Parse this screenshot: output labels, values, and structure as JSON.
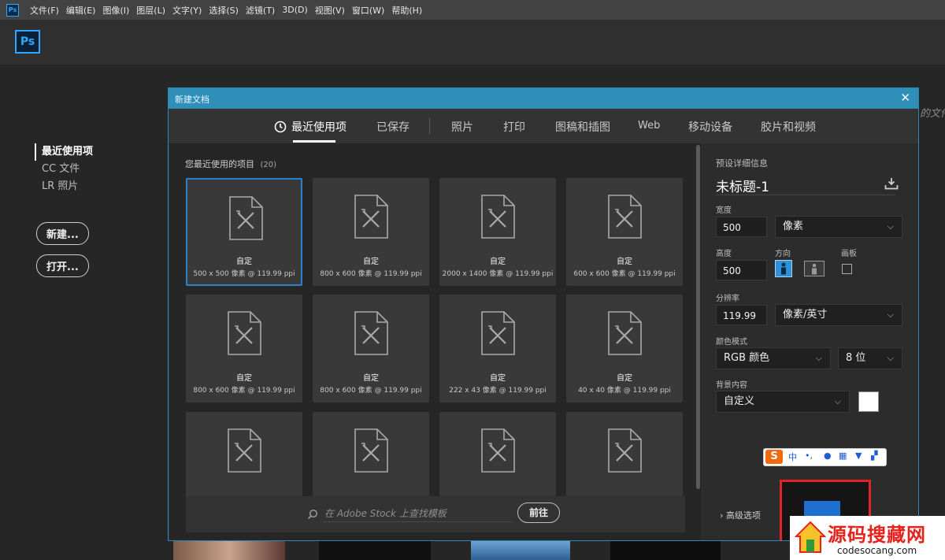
{
  "menu": {
    "app_icon": "Ps",
    "items": [
      "文件(F)",
      "编辑(E)",
      "图像(I)",
      "图层(L)",
      "文字(Y)",
      "选择(S)",
      "滤镜(T)",
      "3D(D)",
      "视图(V)",
      "窗口(W)",
      "帮助(H)"
    ]
  },
  "app": {
    "logo": "Ps"
  },
  "home_nav": {
    "items": [
      "最近使用项",
      "CC 文件",
      "LR 照片"
    ],
    "new_label": "新建...",
    "open_label": "打开..."
  },
  "background_partial_text": "的文件",
  "dialog": {
    "title": "新建文档",
    "close": "✕",
    "tabs": [
      "最近使用项",
      "已保存",
      "照片",
      "打印",
      "图稿和插图",
      "Web",
      "移动设备",
      "胶片和视频"
    ],
    "section_label": "您最近使用的项目",
    "section_count": "(20)",
    "presets": [
      {
        "name": "自定",
        "size": "500 x 500 像素 @ 119.99 ppi"
      },
      {
        "name": "自定",
        "size": "800 x 600 像素 @ 119.99 ppi"
      },
      {
        "name": "自定",
        "size": "2000 x 1400 像素 @ 119.99 ppi"
      },
      {
        "name": "自定",
        "size": "600 x 600 像素 @ 119.99 ppi"
      },
      {
        "name": "自定",
        "size": "800 x 600 像素 @ 119.99 ppi"
      },
      {
        "name": "自定",
        "size": "800 x 600 像素 @ 119.99 ppi"
      },
      {
        "name": "自定",
        "size": "222 x 43 像素 @ 119.99 ppi"
      },
      {
        "name": "自定",
        "size": "40 x 40 像素 @ 119.99 ppi"
      },
      {
        "name": "",
        "size": ""
      },
      {
        "name": "",
        "size": ""
      },
      {
        "name": "",
        "size": ""
      },
      {
        "name": "",
        "size": ""
      }
    ],
    "stock": {
      "placeholder": "在 Adobe Stock 上查找模板",
      "button": "前往"
    },
    "details": {
      "heading": "预设详细信息",
      "doc_name": "未标题-1",
      "width_label": "宽度",
      "width_value": "500",
      "width_unit": "像素",
      "height_label": "高度",
      "height_value": "500",
      "orientation_label": "方向",
      "artboard_label": "画板",
      "resolution_label": "分辨率",
      "resolution_value": "119.99",
      "resolution_unit": "像素/英寸",
      "color_mode_label": "颜色模式",
      "color_mode": "RGB 颜色",
      "bit_depth": "8 位",
      "background_label": "背景内容",
      "background": "自定义",
      "advanced": "高级选项"
    }
  },
  "ime_toolbar": {
    "logo": "S",
    "mode": "中"
  },
  "watermark": {
    "title": "源码搜藏网",
    "url": "codesocang.com"
  },
  "colors": {
    "accent": "#2f8fb9",
    "selected_border": "#2d7fd0",
    "panel": "#333333",
    "dark": "#262626"
  }
}
